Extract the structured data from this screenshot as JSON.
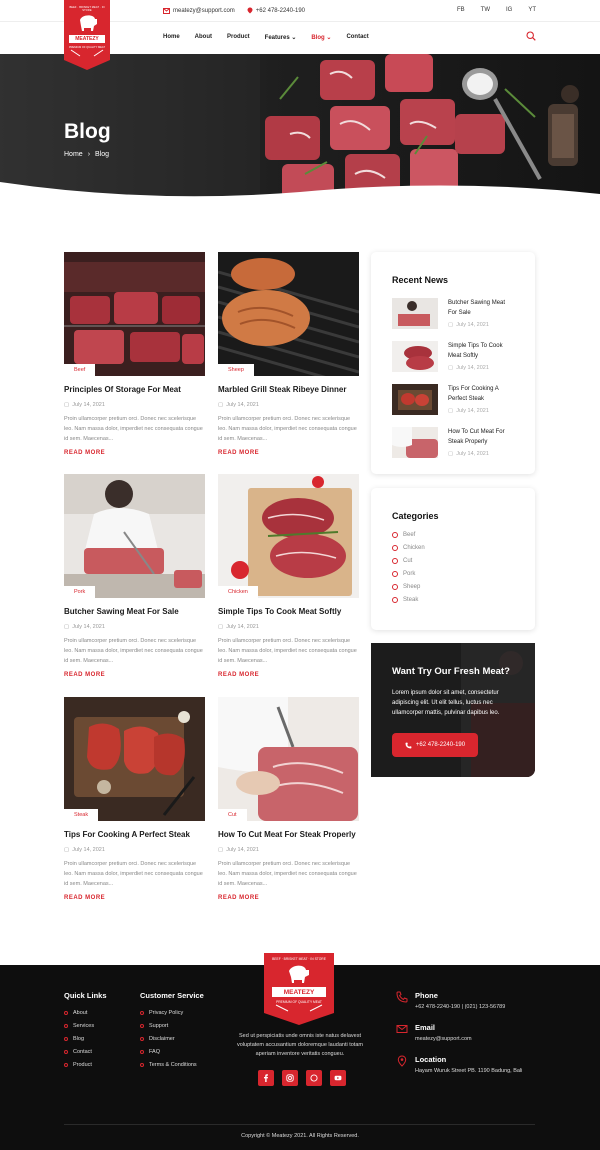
{
  "topbar": {
    "email": "meatezy@support.com",
    "phone": "+62 478-2240-190",
    "social": [
      "FB",
      "TW",
      "IG",
      "YT"
    ]
  },
  "brand": {
    "name": "MEATEZY",
    "arc_text": "BEEF · BRISKET MEAT · IN STORE",
    "tagline": "PREMIUM OF QUALITY MEAT"
  },
  "nav": {
    "items": [
      "Home",
      "About",
      "Product",
      "Features",
      "Blog",
      "Contact"
    ],
    "active": "Blog"
  },
  "hero": {
    "title": "Blog",
    "breadcrumb": [
      "Home",
      "Blog"
    ]
  },
  "posts": [
    {
      "tag": "Beef",
      "title": "Principles Of Storage For Meat",
      "date": "July 14, 2021",
      "excerpt": "Proin ullamcorper pretium orci. Donec nec scelerisque leo. Nam massa dolor, imperdiet nec consequata congue id sem. Maecenas...",
      "more": "READ MORE"
    },
    {
      "tag": "Sheep",
      "title": "Marbled Grill Steak Ribeye Dinner",
      "date": "July 14, 2021",
      "excerpt": "Proin ullamcorper pretium orci. Donec nec scelerisque leo. Nam massa dolor, imperdiet nec consequata congue id sem. Maecenas...",
      "more": "READ MORE"
    },
    {
      "tag": "Pork",
      "title": "Butcher Sawing Meat For Sale",
      "date": "July 14, 2021",
      "excerpt": "Proin ullamcorper pretium orci. Donec nec scelerisque leo. Nam massa dolor, imperdiet nec consequata congue id sem. Maecenas...",
      "more": "READ MORE"
    },
    {
      "tag": "Chicken",
      "title": "Simple Tips To Cook Meat Softly",
      "date": "July 14, 2021",
      "excerpt": "Proin ullamcorper pretium orci. Donec nec scelerisque leo. Nam massa dolor, imperdiet nec consequata congue id sem. Maecenas...",
      "more": "READ MORE"
    },
    {
      "tag": "Steak",
      "title": "Tips For Cooking A Perfect Steak",
      "date": "July 14, 2021",
      "excerpt": "Proin ullamcorper pretium orci. Donec nec scelerisque leo. Nam massa dolor, imperdiet nec consequata congue id sem. Maecenas...",
      "more": "READ MORE"
    },
    {
      "tag": "Cut",
      "title": "How To Cut Meat For Steak Properly",
      "date": "July 14, 2021",
      "excerpt": "Proin ullamcorper pretium orci. Donec nec scelerisque leo. Nam massa dolor, imperdiet nec consequata congue id sem. Maecenas...",
      "more": "READ MORE"
    }
  ],
  "recent_news": {
    "title": "Recent News",
    "items": [
      {
        "title": "Butcher Sawing Meat For Sale",
        "date": "July 14, 2021"
      },
      {
        "title": "Simple Tips To Cook Meat Softly",
        "date": "July 14, 2021"
      },
      {
        "title": "Tips For Cooking A Perfect Steak",
        "date": "July 14, 2021"
      },
      {
        "title": "How To Cut Meat For Steak Properly",
        "date": "July 14, 2021"
      }
    ]
  },
  "categories": {
    "title": "Categories",
    "items": [
      "Beef",
      "Chicken",
      "Cut",
      "Pork",
      "Sheep",
      "Steak"
    ]
  },
  "promo": {
    "title": "Want Try Our Fresh Meat?",
    "text": "Lorem ipsum dolor sit amet, consectetur adipiscing elit. Ut elit tellus, luctus nec ullamcorper mattis, pulvinar dapibus leo.",
    "button": "+62 478-2240-190"
  },
  "footer": {
    "quick_links_title": "Quick Links",
    "quick_links": [
      "About",
      "Services",
      "Blog",
      "Contact",
      "Product"
    ],
    "customer_service_title": "Customer Service",
    "customer_service": [
      "Privacy Policy",
      "Support",
      "Disclaimer",
      "FAQ",
      "Terms & Conditions"
    ],
    "about": "Sed ut perspiciatis unde omnis iste natus delavest voluptatem accusantium doloremque laudanti totam aperiam inventore veritatis congueu.",
    "phone_label": "Phone",
    "phone_value": "+62 478-2240-190 | (021) 123-56789",
    "email_label": "Email",
    "email_value": "meatezy@support.com",
    "location_label": "Location",
    "location_value": "Hayam Wuruk Street PB. 1190 Badung, Bali",
    "copyright": "Copyright © Meatezy 2021. All Rights Reserved."
  },
  "colors": {
    "accent": "#d8262e",
    "footer_bg": "#0e0e0e",
    "text_dark": "#1b1b1b"
  }
}
